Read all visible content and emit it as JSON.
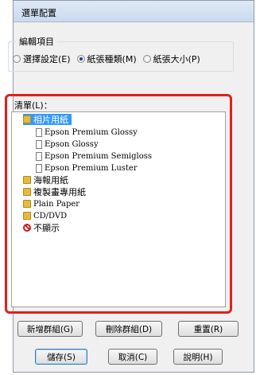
{
  "dialog": {
    "title": "選單配置"
  },
  "edit_group": {
    "label": "編輯項目",
    "options": [
      {
        "label": "選擇設定(E)",
        "checked": false
      },
      {
        "label": "紙張種類(M)",
        "checked": true
      },
      {
        "label": "紙張大小(P)",
        "checked": false
      }
    ]
  },
  "list": {
    "label": "清單(L)：",
    "items": [
      {
        "label": "相片用紙",
        "icon": "folder-icon",
        "level": 0,
        "selected": true
      },
      {
        "label": "Epson Premium Glossy",
        "icon": "document-icon",
        "level": 1
      },
      {
        "label": "Epson Glossy",
        "icon": "document-icon",
        "level": 1
      },
      {
        "label": "Epson Premium Semigloss",
        "icon": "document-icon",
        "level": 1
      },
      {
        "label": "Epson Premium Luster",
        "icon": "document-icon",
        "level": 1
      },
      {
        "label": "海報用紙",
        "icon": "folder-icon",
        "level": 0
      },
      {
        "label": "複製畫專用紙",
        "icon": "folder-icon",
        "level": 0
      },
      {
        "label": "Plain Paper",
        "icon": "folder-icon",
        "level": 0
      },
      {
        "label": "CD/DVD",
        "icon": "folder-icon",
        "level": 0
      },
      {
        "label": "不顯示",
        "icon": "no-show-icon",
        "level": 0
      }
    ]
  },
  "list_buttons": {
    "add_group": "新增群組(G)",
    "delete_group": "刪除群組(D)",
    "reset": "重置(R)"
  },
  "footer_buttons": {
    "save": "儲存(S)",
    "cancel": "取消(C)",
    "help": "說明(H)"
  },
  "colors": {
    "highlight_border": "#e0201c",
    "selection": "#3399ff"
  }
}
